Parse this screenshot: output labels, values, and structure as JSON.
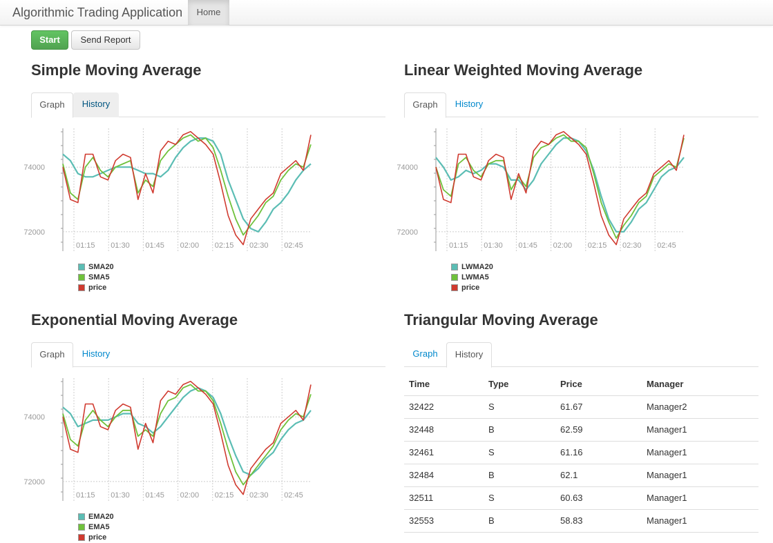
{
  "navbar": {
    "brand": "Algorithmic Trading Application",
    "home": "Home"
  },
  "buttons": {
    "start": "Start",
    "send_report": "Send Report"
  },
  "colors": {
    "slow": "#5bbdb4",
    "fast": "#6fc13b",
    "price": "#d03a2f",
    "grid": "#cccccc"
  },
  "panels": {
    "sma": {
      "title": "Simple Moving Average",
      "tab_graph": "Graph",
      "tab_history": "History",
      "legend": [
        "SMA20",
        "SMA5",
        "price"
      ]
    },
    "lwma": {
      "title": "Linear Weighted Moving Average",
      "tab_graph": "Graph",
      "tab_history": "History",
      "legend": [
        "LWMA20",
        "LWMA5",
        "price"
      ]
    },
    "ema": {
      "title": "Exponential Moving Average",
      "tab_graph": "Graph",
      "tab_history": "History",
      "legend": [
        "EMA20",
        "EMA5",
        "price"
      ]
    },
    "tma": {
      "title": "Triangular Moving Average",
      "tab_graph": "Graph",
      "tab_history": "History"
    }
  },
  "history_table": {
    "headers": [
      "Time",
      "Type",
      "Price",
      "Manager"
    ],
    "rows": [
      [
        "32422",
        "S",
        "61.67",
        "Manager2"
      ],
      [
        "32448",
        "B",
        "62.59",
        "Manager1"
      ],
      [
        "32461",
        "S",
        "61.16",
        "Manager1"
      ],
      [
        "32484",
        "B",
        "62.1",
        "Manager1"
      ],
      [
        "32511",
        "S",
        "60.63",
        "Manager1"
      ],
      [
        "32553",
        "B",
        "58.83",
        "Manager1"
      ]
    ]
  },
  "chart_data": [
    {
      "type": "line",
      "x_ticks": [
        "01:15",
        "01:30",
        "01:45",
        "02:00",
        "02:15",
        "02:30",
        "02:45"
      ],
      "y_ticks": [
        74000,
        72000
      ],
      "ylim": [
        71400,
        75200
      ],
      "grid": true,
      "legend": "bottom-left",
      "series": [
        {
          "name": "SMA20",
          "values": [
            74400,
            74200,
            73800,
            73700,
            73700,
            73800,
            73900,
            74000,
            74000,
            74000,
            73900,
            73800,
            73800,
            73700,
            73900,
            74300,
            74600,
            74800,
            74900,
            74900,
            74800,
            74400,
            73600,
            73000,
            72400,
            72100,
            72000,
            72300,
            72700,
            72900,
            73200,
            73600,
            73900,
            74100
          ]
        },
        {
          "name": "SMA5",
          "values": [
            74100,
            73200,
            73000,
            74000,
            74300,
            73900,
            73700,
            74000,
            74100,
            74200,
            73200,
            73600,
            73400,
            74200,
            74500,
            74700,
            74900,
            75000,
            74800,
            74900,
            74600,
            73900,
            73100,
            72400,
            71900,
            72200,
            72500,
            72900,
            73100,
            73600,
            73900,
            74100,
            74000,
            74700
          ]
        },
        {
          "name": "price",
          "values": [
            74000,
            73000,
            72900,
            74400,
            74400,
            73700,
            73600,
            74200,
            74400,
            74300,
            73000,
            73800,
            73200,
            74500,
            74800,
            74700,
            75000,
            75100,
            74900,
            74700,
            74400,
            73500,
            72500,
            71900,
            71600,
            72400,
            72700,
            73000,
            73200,
            73800,
            74000,
            74200,
            73900,
            75000
          ]
        }
      ]
    },
    {
      "type": "line",
      "x_ticks": [
        "01:15",
        "01:30",
        "01:45",
        "02:00",
        "02:15",
        "02:30",
        "02:45"
      ],
      "y_ticks": [
        74000,
        72000
      ],
      "ylim": [
        71400,
        75200
      ],
      "grid": true,
      "legend": "bottom-left",
      "series": [
        {
          "name": "LWMA20",
          "values": [
            74300,
            74000,
            73600,
            73700,
            73900,
            73800,
            73900,
            74100,
            74100,
            74000,
            73600,
            73600,
            73300,
            73600,
            74100,
            74400,
            74700,
            74900,
            74900,
            74800,
            74500,
            73900,
            73100,
            72400,
            72000,
            72000,
            72300,
            72700,
            72900,
            73300,
            73700,
            73900,
            74000,
            74300
          ]
        },
        {
          "name": "LWMA5",
          "values": [
            74000,
            73300,
            73100,
            74100,
            74300,
            73900,
            73700,
            74100,
            74200,
            74200,
            73300,
            73700,
            73400,
            74300,
            74600,
            74700,
            74900,
            75000,
            74800,
            74800,
            74600,
            73800,
            72900,
            72300,
            71800,
            72200,
            72500,
            72900,
            73100,
            73700,
            73900,
            74100,
            74000,
            74900
          ]
        },
        {
          "name": "price",
          "values": [
            74000,
            73000,
            72900,
            74400,
            74400,
            73700,
            73600,
            74200,
            74400,
            74300,
            73000,
            73800,
            73200,
            74500,
            74800,
            74700,
            75000,
            75100,
            74900,
            74700,
            74400,
            73500,
            72500,
            71900,
            71600,
            72400,
            72700,
            73000,
            73200,
            73800,
            74000,
            74200,
            73900,
            75000
          ]
        }
      ]
    },
    {
      "type": "line",
      "x_ticks": [
        "01:15",
        "01:30",
        "01:45",
        "02:00",
        "02:15",
        "02:30",
        "02:45"
      ],
      "y_ticks": [
        74000,
        72000
      ],
      "ylim": [
        71400,
        75200
      ],
      "grid": true,
      "legend": "bottom-left",
      "series": [
        {
          "name": "EMA20",
          "values": [
            74300,
            74100,
            73700,
            73800,
            73900,
            73900,
            73900,
            74000,
            74100,
            74100,
            73800,
            73700,
            73500,
            73700,
            74000,
            74300,
            74600,
            74800,
            74900,
            74800,
            74600,
            74100,
            73400,
            72800,
            72300,
            72200,
            72400,
            72700,
            72900,
            73300,
            73600,
            73800,
            73900,
            74200
          ]
        },
        {
          "name": "EMA5",
          "values": [
            74100,
            73300,
            73100,
            73900,
            74200,
            73900,
            73700,
            74000,
            74200,
            74200,
            73400,
            73600,
            73400,
            74100,
            74500,
            74600,
            74900,
            75000,
            74800,
            74800,
            74500,
            73800,
            73000,
            72300,
            71900,
            72200,
            72500,
            72800,
            73100,
            73600,
            73900,
            74100,
            74000,
            74700
          ]
        },
        {
          "name": "price",
          "values": [
            74000,
            73000,
            72900,
            74400,
            74400,
            73700,
            73600,
            74200,
            74400,
            74300,
            73000,
            73800,
            73200,
            74500,
            74800,
            74700,
            75000,
            75100,
            74900,
            74700,
            74400,
            73500,
            72500,
            71900,
            71600,
            72400,
            72700,
            73000,
            73200,
            73800,
            74000,
            74200,
            73900,
            75000
          ]
        }
      ]
    }
  ]
}
